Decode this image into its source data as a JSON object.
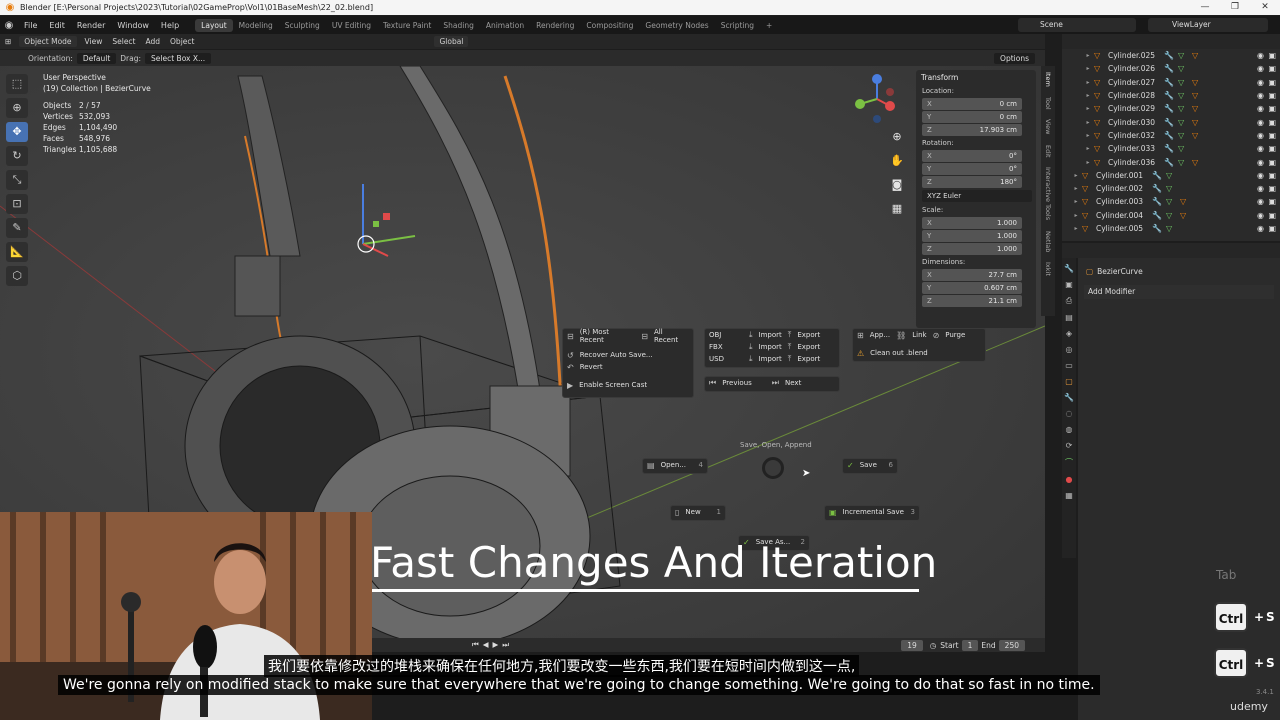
{
  "window": {
    "title": "Blender [E:\\Personal Projects\\2023\\Tutorial\\02GameProp\\Vol1\\01BaseMesh\\22_02.blend]",
    "controls": [
      "—",
      "❐",
      "✕"
    ]
  },
  "menubar": {
    "menus": [
      "File",
      "Edit",
      "Render",
      "Window",
      "Help"
    ],
    "workspaces": [
      "Layout",
      "Modeling",
      "Sculpting",
      "UV Editing",
      "Texture Paint",
      "Shading",
      "Animation",
      "Rendering",
      "Compositing",
      "Geometry Nodes",
      "Scripting",
      "+"
    ],
    "active_workspace": "Layout",
    "scene": "Scene",
    "view_layer": "ViewLayer"
  },
  "viewport_header": {
    "mode": "Object Mode",
    "menus": [
      "View",
      "Select",
      "Add",
      "Object"
    ],
    "transform_orientation": "Global",
    "options": "Options"
  },
  "tool_header": {
    "orientation_label": "Orientation:",
    "orientation_value": "Default",
    "drag_label": "Drag:",
    "drag_value": "Select Box X..."
  },
  "stats": {
    "view": "User Perspective",
    "collection": "(19) Collection | BezierCurve",
    "rows": [
      {
        "k": "Objects",
        "v": "2 / 57"
      },
      {
        "k": "Vertices",
        "v": "532,093"
      },
      {
        "k": "Edges",
        "v": "1,104,490"
      },
      {
        "k": "Faces",
        "v": "548,976"
      },
      {
        "k": "Triangles",
        "v": "1,105,688"
      }
    ]
  },
  "npanel": {
    "header": "Transform",
    "location_label": "Location:",
    "location": [
      {
        "k": "X",
        "v": "0 cm"
      },
      {
        "k": "Y",
        "v": "0 cm"
      },
      {
        "k": "Z",
        "v": "17.903 cm"
      }
    ],
    "rotation_label": "Rotation:",
    "rotation": [
      {
        "k": "X",
        "v": "0°"
      },
      {
        "k": "Y",
        "v": "0°"
      },
      {
        "k": "Z",
        "v": "180°"
      }
    ],
    "rotation_mode": "XYZ Euler",
    "scale_label": "Scale:",
    "scale": [
      {
        "k": "X",
        "v": "1.000"
      },
      {
        "k": "Y",
        "v": "1.000"
      },
      {
        "k": "Z",
        "v": "1.000"
      }
    ],
    "dimensions_label": "Dimensions:",
    "dimensions": [
      {
        "k": "X",
        "v": "27.7 cm"
      },
      {
        "k": "Y",
        "v": "0.607 cm"
      },
      {
        "k": "Z",
        "v": "21.1 cm"
      }
    ],
    "tabs": [
      "Item",
      "Tool",
      "View",
      "Edit",
      "Interactive Tools",
      "Netlab",
      "Ixkit"
    ]
  },
  "pie_menu": {
    "recent": {
      "most_recent": "(R) Most Recent",
      "all_recent": "All Recent",
      "recover": "Recover Auto Save...",
      "revert": "Revert",
      "screencast": "Enable Screen Cast"
    },
    "formats": [
      {
        "fmt": "OBJ",
        "import": "Import",
        "export": "Export"
      },
      {
        "fmt": "FBX",
        "import": "Import",
        "export": "Export"
      },
      {
        "fmt": "USD",
        "import": "Import",
        "export": "Export"
      }
    ],
    "nav": {
      "previous": "Previous",
      "next": "Next"
    },
    "append": {
      "app": "App...",
      "link": "Link",
      "purge": "Purge",
      "clean": "Clean out .blend"
    },
    "center_label": "Save, Open, Append",
    "open": {
      "label": "Open...",
      "num": "4"
    },
    "save": {
      "label": "Save",
      "num": "6"
    },
    "new": {
      "label": "New",
      "num": "1"
    },
    "incremental": {
      "label": "Incremental Save",
      "num": "3"
    },
    "save_as": {
      "label": "Save As...",
      "num": "2"
    }
  },
  "overlay_title": "Fast Changes And Iteration",
  "timeline": {
    "frame": "19",
    "start_label": "Start",
    "start": "1",
    "end_label": "End",
    "end": "250"
  },
  "outliner": {
    "rows": [
      {
        "name": "Cylinder.025",
        "nested": true,
        "mat": true
      },
      {
        "name": "Cylinder.026",
        "nested": true,
        "mat": false
      },
      {
        "name": "Cylinder.027",
        "nested": true,
        "mat": true
      },
      {
        "name": "Cylinder.028",
        "nested": true,
        "mat": true
      },
      {
        "name": "Cylinder.029",
        "nested": true,
        "mat": true
      },
      {
        "name": "Cylinder.030",
        "nested": true,
        "mat": true
      },
      {
        "name": "Cylinder.032",
        "nested": true,
        "mat": true
      },
      {
        "name": "Cylinder.033",
        "nested": true,
        "mat": false
      },
      {
        "name": "Cylinder.036",
        "nested": true,
        "mat": true
      },
      {
        "name": "Cylinder.001",
        "nested": false,
        "mat": false
      },
      {
        "name": "Cylinder.002",
        "nested": false,
        "mat": false
      },
      {
        "name": "Cylinder.003",
        "nested": false,
        "mat": true
      },
      {
        "name": "Cylinder.004",
        "nested": false,
        "mat": true
      },
      {
        "name": "Cylinder.005",
        "nested": false,
        "mat": false
      }
    ]
  },
  "properties": {
    "object": "BezierCurve",
    "add_modifier": "Add Modifier"
  },
  "keys": {
    "tab": "Tab",
    "ctrl1": "Ctrl",
    "s1": "S",
    "ctrl2": "Ctrl",
    "s2": "S"
  },
  "subtitles": {
    "cn": "我们要依靠修改过的堆栈来确保在任何地方,我们要改变一些东西,我们要在短时间内做到这一点,",
    "en": "We're gonna rely on modified stack to make sure that everywhere that we're going to change something. We're going to do that so fast in no time."
  },
  "footer": {
    "version": "3.4.1",
    "brand": "udemy"
  },
  "colors": {
    "accent": "#4772b3",
    "orange": "#e87d0d",
    "green": "#6fc765"
  }
}
